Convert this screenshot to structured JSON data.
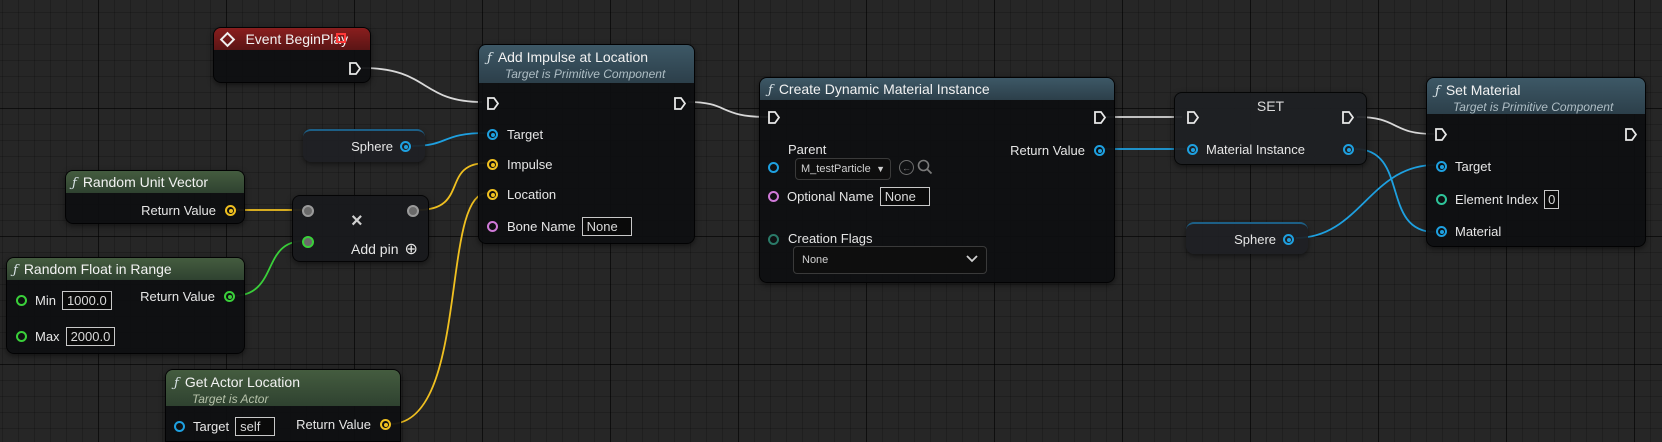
{
  "graph": {
    "event_begin_play": {
      "title": "Event BeginPlay"
    },
    "add_impulse": {
      "title": "Add Impulse at Location",
      "subtitle": "Target is Primitive Component",
      "pins": {
        "target": "Target",
        "impulse": "Impulse",
        "location": "Location",
        "bone_name": "Bone Name"
      },
      "bone_name_value": "None"
    },
    "sphere_var_1": {
      "label": "Sphere"
    },
    "random_unit_vector": {
      "title": "Random Unit Vector",
      "return_label": "Return Value"
    },
    "random_float": {
      "title": "Random Float in Range",
      "min_label": "Min",
      "min_value": "1000.0",
      "max_label": "Max",
      "max_value": "2000.0",
      "return_label": "Return Value"
    },
    "multiply": {
      "symbol": "×",
      "add_pin_label": "Add pin",
      "add_pin_icon": "⊕"
    },
    "get_actor_location": {
      "title": "Get Actor Location",
      "subtitle": "Target is Actor",
      "target_label": "Target",
      "target_value": "self",
      "return_label": "Return Value"
    },
    "create_dmi": {
      "title": "Create Dynamic Material Instance",
      "parent_label": "Parent",
      "parent_value": "M_testParticle",
      "optional_name_label": "Optional Name",
      "optional_name_value": "None",
      "creation_flags_label": "Creation Flags",
      "creation_flags_value": "None",
      "return_label": "Return Value"
    },
    "set_node": {
      "title": "SET",
      "pin_label": "Material Instance"
    },
    "sphere_var_2": {
      "label": "Sphere"
    },
    "set_material": {
      "title": "Set Material",
      "subtitle": "Target is Primitive Component",
      "target_label": "Target",
      "element_index_label": "Element Index",
      "element_index_value": "0",
      "material_label": "Material"
    }
  },
  "colors": {
    "exec": "#e8e8e8",
    "object": "#1ea0e0",
    "vector": "#f0c020",
    "float": "#3ad03a",
    "name": "#d07ad8",
    "int": "#2ec49a"
  }
}
